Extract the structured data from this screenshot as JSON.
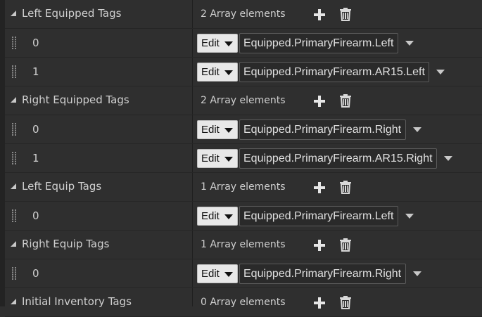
{
  "sections": [
    {
      "title": "Left Equipped Tags",
      "count_label": "2 Array elements",
      "items": [
        {
          "index": "0",
          "edit_label": "Edit",
          "tag": "Equipped.PrimaryFirearm.Left"
        },
        {
          "index": "1",
          "edit_label": "Edit",
          "tag": "Equipped.PrimaryFirearm.AR15.Left"
        }
      ]
    },
    {
      "title": "Right Equipped Tags",
      "count_label": "2 Array elements",
      "items": [
        {
          "index": "0",
          "edit_label": "Edit",
          "tag": "Equipped.PrimaryFirearm.Right"
        },
        {
          "index": "1",
          "edit_label": "Edit",
          "tag": "Equipped.PrimaryFirearm.AR15.Right"
        }
      ]
    },
    {
      "title": "Left Equip Tags",
      "count_label": "1 Array elements",
      "items": [
        {
          "index": "0",
          "edit_label": "Edit",
          "tag": "Equipped.PrimaryFirearm.Left"
        }
      ]
    },
    {
      "title": "Right Equip Tags",
      "count_label": "1 Array elements",
      "items": [
        {
          "index": "0",
          "edit_label": "Edit",
          "tag": "Equipped.PrimaryFirearm.Right"
        }
      ]
    },
    {
      "title": "Initial Inventory Tags",
      "count_label": "0 Array elements",
      "items": []
    }
  ],
  "icons": {
    "add": "plus-icon",
    "remove": "trash-icon",
    "drag": "grip-icon",
    "expand": "collapse-triangle-icon"
  }
}
